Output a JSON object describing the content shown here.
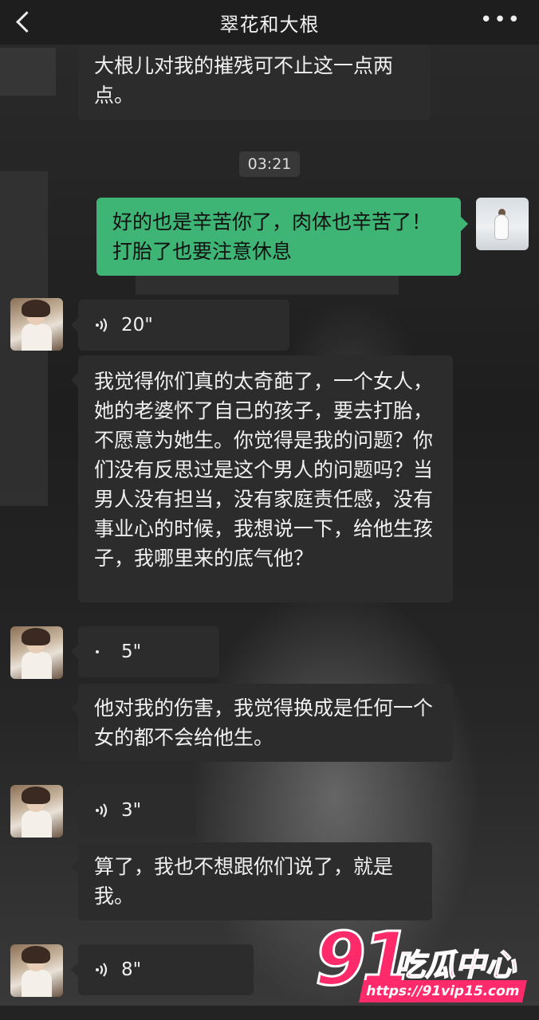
{
  "header": {
    "title": "翠花和大根"
  },
  "messages": {
    "m1": "大根儿对我的摧残可不止这一点两点。",
    "time": "03:21",
    "m2": "好的也是辛苦你了，肉体也辛苦了！打胎了也要注意休息",
    "v1": "20\"",
    "m3": "我觉得你们真的太奇葩了，一个女人，她的老婆怀了自己的孩子，要去打胎，不愿意为她生。你觉得是我的问题？你们没有反思过是这个男人的问题吗？当男人没有担当，没有家庭责任感，没有事业心的时候，我想说一下，给他生孩子，我哪里来的底气他？",
    "v2": "5\"",
    "m4": "他对我的伤害，我觉得换成是任何一个女的都不会给他生。",
    "v3": "3\"",
    "m5": "算了，我也不想跟你们说了，就是我。",
    "v4": "8\""
  },
  "watermark": {
    "num": "91",
    "text": "吃瓜中心",
    "url": "https://91vip15.com"
  }
}
